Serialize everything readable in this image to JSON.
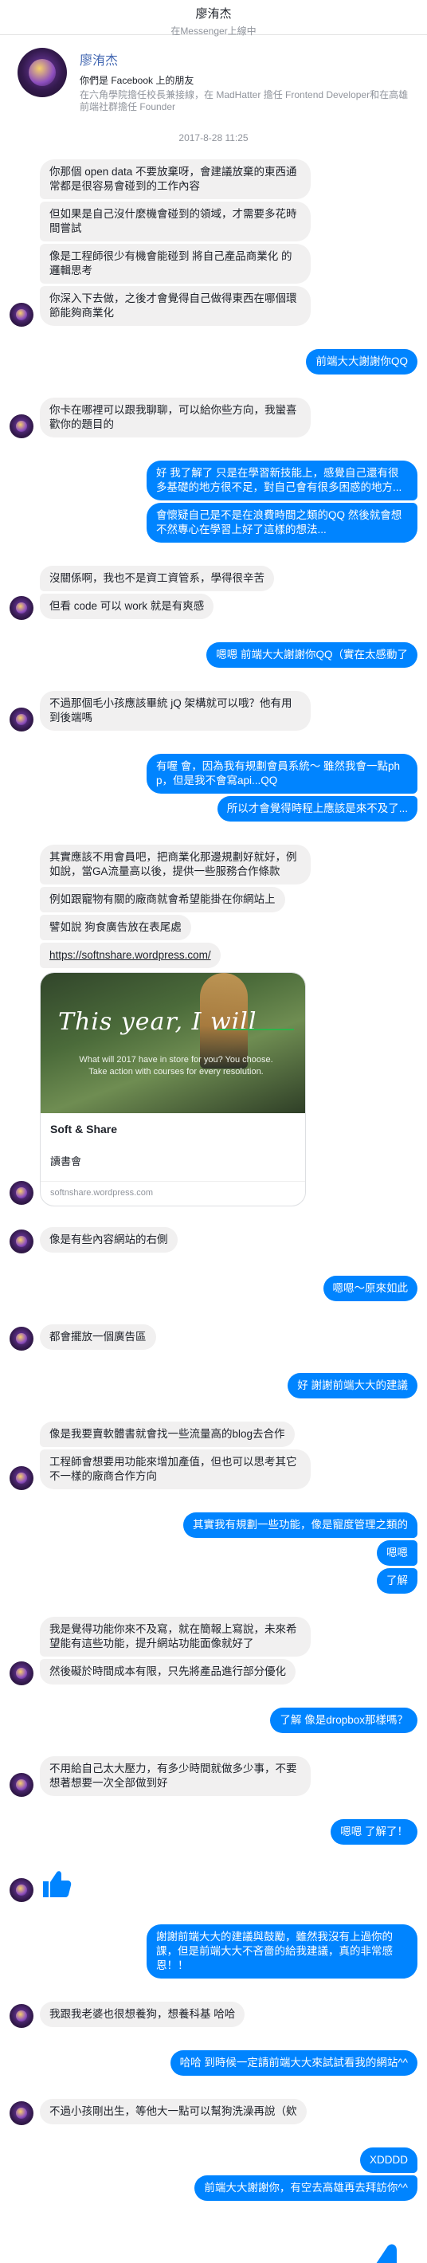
{
  "header": {
    "name": "廖洧杰",
    "status": "在Messenger上線中"
  },
  "profile": {
    "name": "廖洧杰",
    "friend_text": "你們是 Facebook 上的朋友",
    "job": "在六角學院擔任校長兼接線，在 MadHatter 擔任 Frontend Developer和在高雄前端社群擔任 Founder"
  },
  "timestamp": "2017-8-28 11:25",
  "messages": [
    {
      "side": "left",
      "bubbles": [
        "你那個 open data 不要放棄呀，會建議放棄的東西通常都是很容易會碰到的工作內容",
        "但如果是自己沒什麼機會碰到的領域，才需要多花時間嘗試",
        "像是工程師很少有機會能碰到 將自己產品商業化 的邏輯思考",
        "你深入下去做，之後才會覺得自己做得東西在哪個環節能夠商業化"
      ]
    },
    {
      "side": "right",
      "bubbles": [
        "前端大大謝謝你QQ"
      ]
    },
    {
      "side": "left",
      "bubbles": [
        "你卡在哪裡可以跟我聊聊，可以給你些方向，我蠻喜歡你的題目的"
      ]
    },
    {
      "side": "right",
      "bubbles": [
        "好  我了解了  只是在學習新技能上，感覺自己還有很多基礎的地方很不足，對自己會有很多困惑的地方...",
        "會懷疑自己是不是在浪費時間之類的QQ 然後就會想不然專心在學習上好了這樣的想法..."
      ]
    },
    {
      "side": "left",
      "bubbles": [
        "沒關係啊，我也不是資工資管系，學得很辛苦",
        "但看 code 可以 work 就是有爽感"
      ]
    },
    {
      "side": "right",
      "bubbles": [
        "嗯嗯 前端大大謝謝你QQ（實在太感動了"
      ]
    },
    {
      "side": "left",
      "bubbles": [
        "不過那個毛小孩應該畢統 jQ 架構就可以哦？他有用到後端嗎"
      ]
    },
    {
      "side": "right",
      "bubbles": [
        "有喔 會，因為我有規劃會員系統～ 雖然我會一點php，但是我不會寫api...QQ",
        "所以才會覺得時程上應該是來不及了..."
      ]
    },
    {
      "side": "left",
      "bubbles": [
        "其實應該不用會員吧，把商業化那邊規劃好就好，例如說，當GA流量高以後，提供一些服務合作條款",
        "例如跟寵物有關的廠商就會希望能掛在你網站上",
        "譬如說 狗食廣告放在表尾處",
        "https://softnshare.wordpress.com/"
      ],
      "card": {
        "headline": "This year, I will",
        "sub": "What will 2017 have in store for you? You choose. Take action with courses for every resolution.",
        "title": "Soft & Share",
        "desc": "讀書會",
        "domain": "softnshare.wordpress.com"
      }
    },
    {
      "side": "left",
      "bubbles": [
        "像是有些內容網站的右側"
      ]
    },
    {
      "side": "right",
      "bubbles": [
        "嗯嗯～原來如此"
      ]
    },
    {
      "side": "left",
      "bubbles": [
        "都會擺放一個廣告區"
      ]
    },
    {
      "side": "right",
      "bubbles": [
        "好  謝謝前端大大的建議"
      ]
    },
    {
      "side": "left",
      "bubbles": [
        "像是我要賣軟體書就會找一些流量高的blog去合作",
        "工程師會想要用功能來增加產值，但也可以思考其它不一樣的廠商合作方向"
      ]
    },
    {
      "side": "right",
      "bubbles": [
        "其實我有規劃一些功能，像是寵度管理之類的",
        "嗯嗯",
        "了解"
      ]
    },
    {
      "side": "left",
      "bubbles": [
        "我是覺得功能你來不及寫，就在簡報上寫說，未來希望能有這些功能，提升網站功能面像就好了",
        "然後礙於時間成本有限，只先將產品進行部分優化"
      ]
    },
    {
      "side": "right",
      "bubbles": [
        "了解 像是dropbox那樣嗎？"
      ]
    },
    {
      "side": "left",
      "bubbles": [
        "不用給自己太大壓力，有多少時間就做多少事，不要想著想要一次全部做到好"
      ]
    },
    {
      "side": "right",
      "bubbles": [
        "嗯嗯  了解了！"
      ]
    },
    {
      "side": "left",
      "thumb": "small"
    },
    {
      "side": "right",
      "bubbles": [
        "謝謝前端大大的建議與鼓勵，雖然我沒有上過你的課，但是前端大大不吝嗇的給我建議，真的非常感恩！！"
      ]
    },
    {
      "side": "left",
      "bubbles": [
        "我跟我老婆也很想養狗，想養科基 哈哈"
      ]
    },
    {
      "side": "right",
      "bubbles": [
        "哈哈  到時候一定請前端大大來試試看我的網站^^"
      ]
    },
    {
      "side": "left",
      "bubbles": [
        "不過小孩剛出生，等他大一點可以幫狗洗澡再說（欸"
      ]
    },
    {
      "side": "right",
      "bubbles": [
        "XDDDD",
        "前端大大謝謝你，有空去高雄再去拜訪你^^"
      ],
      "thumb": "big"
    }
  ],
  "colors": {
    "accent": "#0084ff",
    "incoming": "#f1f0f0",
    "link": "#4267b2"
  },
  "icons": {
    "avatar": "avatar-icon",
    "like": "thumbs-up-icon"
  }
}
